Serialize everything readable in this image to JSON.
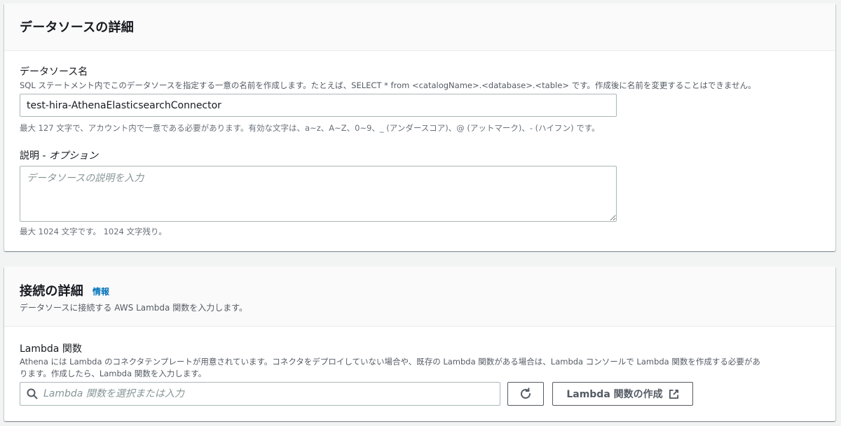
{
  "data_source_details": {
    "title": "データソースの詳細",
    "name_label": "データソース名",
    "name_description": "SQL ステートメント内でこのデータソースを指定する一意の名前を作成します。たとえば、SELECT * from <catalogName>.<database>.<table> です。作成後に名前を変更することはできません。",
    "name_value": "test-hira-AthenaElasticsearchConnector",
    "name_constraint": "最大 127 文字で、アカウント内で一意である必要があります。有効な文字は、a~z、A~Z、0~9、_ (アンダースコア)、@ (アットマーク)、- (ハイフン) です。",
    "description_label": "説明 - ",
    "description_optional": "オプション",
    "description_placeholder": "データソースの説明を入力",
    "description_constraint": "最大 1024 文字です。 1024 文字残り。"
  },
  "connection_details": {
    "title": "接続の詳細",
    "info_link": "情報",
    "subtitle": "データソースに接続する AWS Lambda 関数を入力します。",
    "lambda_label": "Lambda 関数",
    "lambda_description_line1": "Athena には Lambda のコネクタテンプレートが用意されています。コネクタをデプロイしていない場合や、既存の Lambda 関数がある場合は、Lambda コンソールで Lambda 関数を作成する必要があ",
    "lambda_description_line2": "ります。作成したら、Lambda 関数を入力します。",
    "lambda_placeholder": "Lambda 関数を選択または入力",
    "search_icon": "search-icon",
    "refresh_icon": "refresh-icon",
    "create_button_label": "Lambda 関数の作成",
    "external_link_icon": "external-link-icon"
  }
}
